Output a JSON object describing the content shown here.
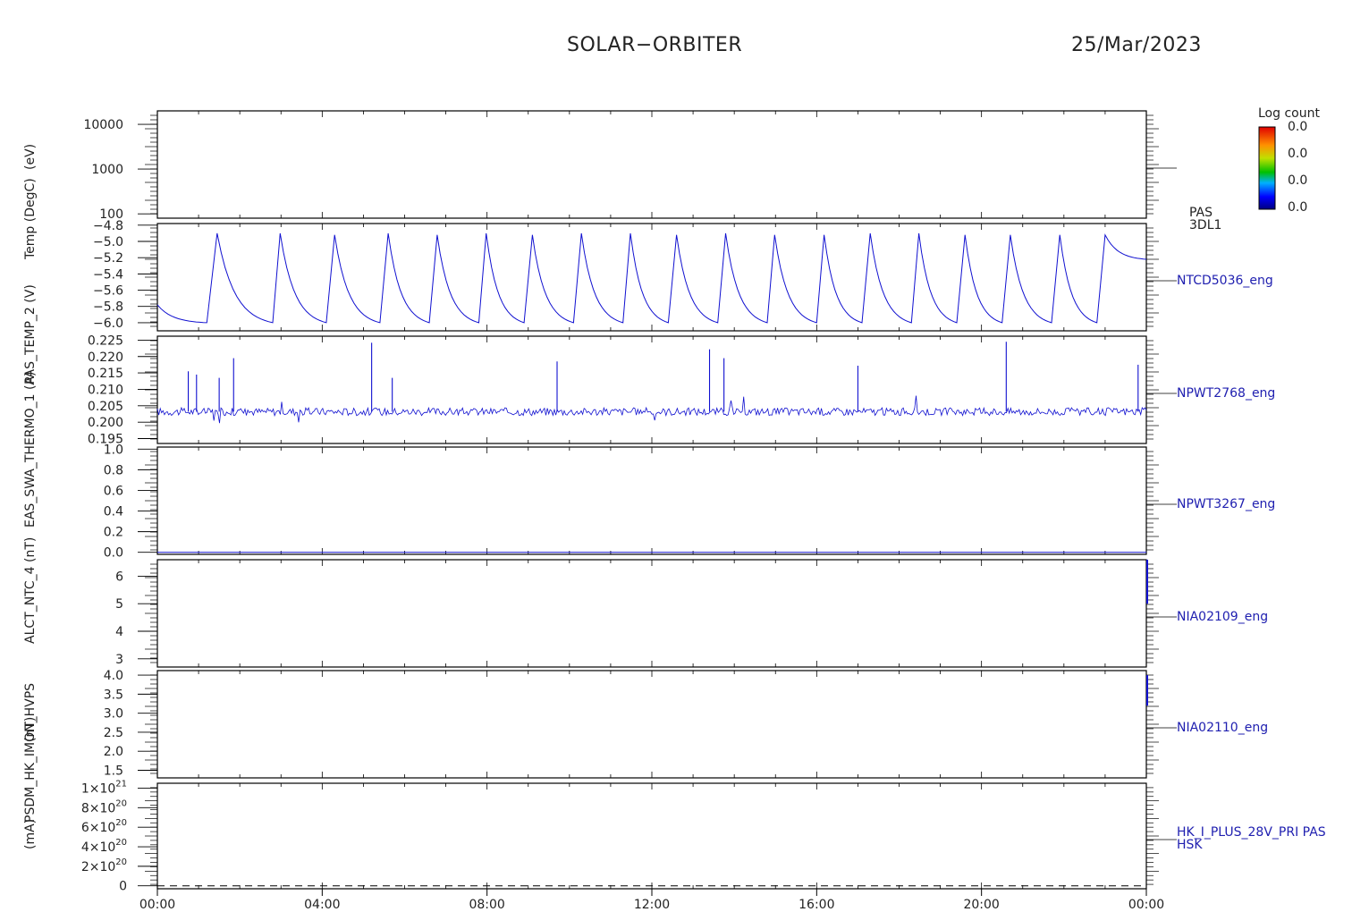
{
  "header": {
    "title": "SOLAR−ORBITER",
    "date": "25/Mar/2023"
  },
  "y_titles": [
    "(eV)",
    "Temp (DegC)",
    "PAS_TEMP_2 (V)",
    "EAS_SWA_THERMO_1 (A)",
    "ALCT_NTC_4 (nT)",
    "(nT)",
    "(mA)",
    "PSDM_HK_IMON_HVPS"
  ],
  "colorbar": {
    "title": "Log count",
    "ticks": [
      "0.0",
      "0.0",
      "0.0",
      "0.0"
    ]
  },
  "x_axis": {
    "ticks": [
      "00:00",
      "04:00",
      "08:00",
      "12:00",
      "16:00",
      "20:00",
      "00:00"
    ]
  },
  "chart_data": [
    {
      "type": "heatmap",
      "panel": 0,
      "right_label": [
        "PAS",
        "3DL1"
      ],
      "log_y": true,
      "yticks": [
        "10000",
        "1000",
        "100"
      ],
      "ytick_values": [
        10000,
        1000,
        100
      ],
      "ylim": [
        80,
        20000
      ]
    },
    {
      "type": "line",
      "panel": 1,
      "right_label": [
        "NTCD5036_eng"
      ],
      "yticks": [
        "−4.8",
        "−5.0",
        "−5.2",
        "−5.4",
        "−5.6",
        "−5.8",
        "−6.0"
      ],
      "ytick_values": [
        -4.8,
        -5.0,
        -5.2,
        -5.4,
        -5.6,
        -5.8,
        -6.0
      ],
      "ylim": [
        -6.1,
        -4.78
      ],
      "series": [
        {
          "x_hours": [
            0.0,
            1.2,
            1.45,
            2.8,
            2.98,
            4.1,
            4.3,
            5.4,
            5.6,
            6.6,
            6.79,
            7.8,
            7.98,
            8.9,
            9.1,
            10.1,
            10.29,
            11.3,
            11.48,
            12.4,
            12.6,
            13.6,
            13.79,
            14.8,
            14.98,
            16.0,
            16.18,
            17.1,
            17.3,
            18.3,
            18.48,
            19.4,
            19.6,
            20.5,
            20.7,
            21.7,
            21.9,
            22.8,
            23.0,
            24.0
          ],
          "values": [
            -5.78,
            -6.0,
            -4.9,
            -6.0,
            -4.9,
            -6.0,
            -4.92,
            -6.0,
            -4.9,
            -6.0,
            -4.92,
            -6.0,
            -4.9,
            -6.0,
            -4.92,
            -6.0,
            -4.9,
            -6.0,
            -4.9,
            -6.0,
            -4.92,
            -6.0,
            -4.9,
            -6.0,
            -4.92,
            -6.0,
            -4.92,
            -6.0,
            -4.9,
            -6.0,
            -4.9,
            -6.0,
            -4.92,
            -6.0,
            -4.92,
            -6.0,
            -4.92,
            -6.0,
            -4.92,
            -5.22
          ]
        }
      ]
    },
    {
      "type": "line",
      "panel": 2,
      "right_label": [
        "NPWT2768_eng"
      ],
      "yticks": [
        "0.225",
        "0.220",
        "0.215",
        "0.210",
        "0.205",
        "0.200",
        "0.195"
      ],
      "ytick_values": [
        0.225,
        0.22,
        0.215,
        0.21,
        0.205,
        0.2,
        0.195
      ],
      "ylim": [
        0.1935,
        0.2262
      ],
      "baseline": 0.2032,
      "noise": 0.0012,
      "spikes": [
        {
          "x": 0.75,
          "y": 0.2155
        },
        {
          "x": 0.95,
          "y": 0.2145
        },
        {
          "x": 1.5,
          "y": 0.2135
        },
        {
          "x": 1.85,
          "y": 0.2195
        },
        {
          "x": 5.2,
          "y": 0.2242
        },
        {
          "x": 5.7,
          "y": 0.2135
        },
        {
          "x": 9.7,
          "y": 0.2185
        },
        {
          "x": 13.4,
          "y": 0.2222
        },
        {
          "x": 13.75,
          "y": 0.2195
        },
        {
          "x": 17.0,
          "y": 0.2172
        },
        {
          "x": 20.6,
          "y": 0.2245
        },
        {
          "x": 23.8,
          "y": 0.2175
        }
      ]
    },
    {
      "type": "line",
      "panel": 3,
      "right_label": [
        "NPWT3267_eng"
      ],
      "yticks": [
        "1.0",
        "0.8",
        "0.6",
        "0.4",
        "0.2",
        "0.0"
      ],
      "ytick_values": [
        1.0,
        0.8,
        0.6,
        0.4,
        0.2,
        0.0
      ],
      "ylim": [
        -0.02,
        1.02
      ],
      "flat_value": 0.0
    },
    {
      "type": "line",
      "panel": 4,
      "right_label": [
        "NIA02109_eng"
      ],
      "yticks": [
        "6",
        "5",
        "4",
        "3"
      ],
      "ytick_values": [
        6,
        5,
        4,
        3
      ],
      "ylim": [
        2.7,
        6.6
      ],
      "edge_segment": [
        5.0,
        6.6
      ]
    },
    {
      "type": "line",
      "panel": 5,
      "right_label": [
        "NIA02110_eng"
      ],
      "yticks": [
        "4.0",
        "3.5",
        "3.0",
        "2.5",
        "2.0",
        "1.5"
      ],
      "ytick_values": [
        4.0,
        3.5,
        3.0,
        2.5,
        2.0,
        1.5
      ],
      "ylim": [
        1.3,
        4.12
      ],
      "edge_segment": [
        3.2,
        4.0
      ]
    },
    {
      "type": "line",
      "panel": 6,
      "right_label": [
        "HK_I_PLUS_28V_PRI PAS",
        "HSK"
      ],
      "yticks": [
        {
          "m": "1×10",
          "e": "21"
        },
        {
          "m": "8×10",
          "e": "20"
        },
        {
          "m": "6×10",
          "e": "20"
        },
        {
          "m": "4×10",
          "e": "20"
        },
        {
          "m": "2×10",
          "e": "20"
        },
        {
          "m": "0",
          "e": ""
        }
      ],
      "ytick_values": [
        1e+21,
        8e+20,
        6e+20,
        4e+20,
        2e+20,
        0
      ],
      "ylim": [
        -3e+19,
        1.05e+21
      ],
      "flat_value": 0,
      "dashed": true
    }
  ]
}
